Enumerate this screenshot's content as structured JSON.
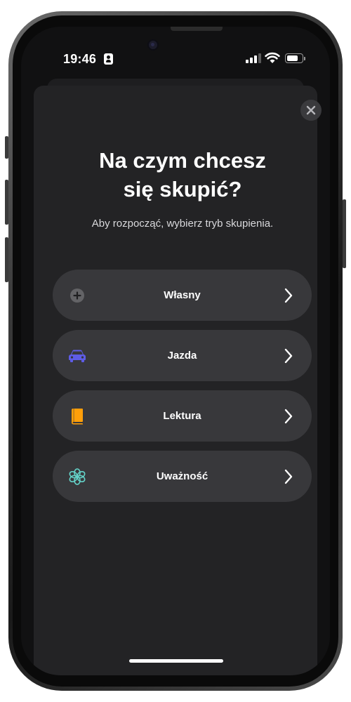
{
  "status_bar": {
    "time": "19:46",
    "signal_bars_active": 3,
    "battery_level": 0.75
  },
  "sheet": {
    "title_line1": "Na czym chcesz",
    "title_line2": "się skupić?",
    "subtitle": "Aby rozpocząć, wybierz tryb skupienia."
  },
  "modes": [
    {
      "label": "Własny",
      "icon": "plus-circle-icon",
      "color": "#636366"
    },
    {
      "label": "Jazda",
      "icon": "car-icon",
      "color": "#5e5ce6"
    },
    {
      "label": "Lektura",
      "icon": "book-icon",
      "color": "#ff9f0a"
    },
    {
      "label": "Uważność",
      "icon": "flower-icon",
      "color": "#64d2c8"
    }
  ],
  "colors": {
    "sheet_background": "#232325",
    "row_background": "#38383b",
    "close_button_background": "#3a3a3d"
  }
}
